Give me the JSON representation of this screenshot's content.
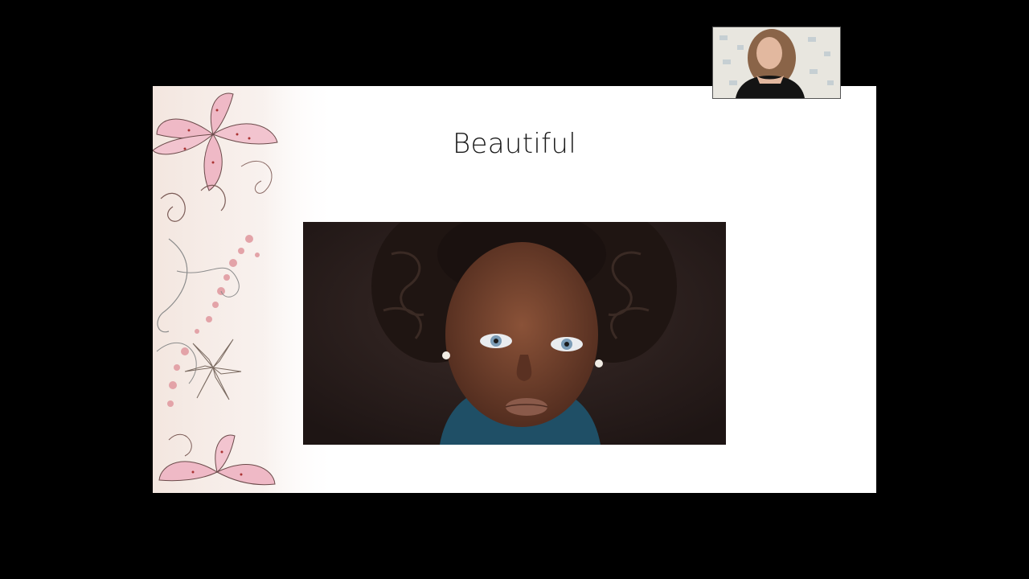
{
  "slide": {
    "title": "Beautiful"
  },
  "images": {
    "photo": "portrait-photo",
    "decoration": "floral-border-illustration",
    "webcam": "presenter-webcam-video"
  },
  "colors": {
    "background": "#000000",
    "slide": "#ffffff",
    "title": "#1a1a1a",
    "floral_pink": "#e8a8b8",
    "photo_backdrop": "#2a1f1d"
  }
}
